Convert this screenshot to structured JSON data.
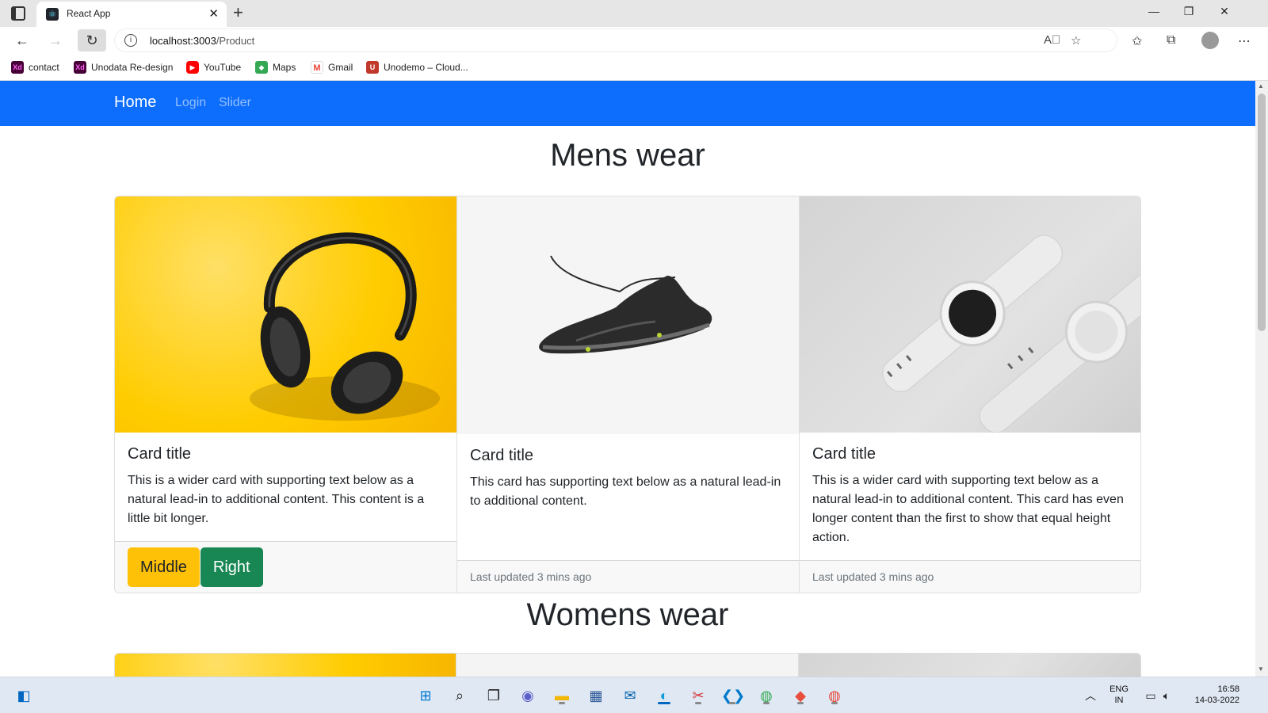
{
  "browser": {
    "tab_title": "React App",
    "tab_close": "✕",
    "new_tab": "+",
    "window_controls": {
      "minimize": "—",
      "restore": "❐",
      "close": "✕"
    },
    "url_host": "localhost:3003",
    "url_path": "/Product",
    "bookmarks": [
      {
        "label": "contact",
        "icon": "Xd"
      },
      {
        "label": "Unodata Re-design",
        "icon": "Xd"
      },
      {
        "label": "YouTube",
        "icon": "▶"
      },
      {
        "label": "Maps",
        "icon": "◆"
      },
      {
        "label": "Gmail",
        "icon": "M"
      },
      {
        "label": "Unodemo – Cloud...",
        "icon": "U"
      }
    ]
  },
  "navbar": {
    "brand": "Home",
    "links": [
      "Login",
      "Slider"
    ],
    "bg_color": "#0d6efd"
  },
  "sections": [
    {
      "title": "Mens wear",
      "cards": [
        {
          "image": "headphones",
          "title": "Card title",
          "text": "This is a wider card with supporting text below as a natural lead-in to additional content. This content is a little bit longer.",
          "buttons": [
            "Middle",
            "Right"
          ]
        },
        {
          "image": "sneaker",
          "title": "Card title",
          "text": "This card has supporting text below as a natural lead-in to additional content.",
          "footer": "Last updated 3 mins ago"
        },
        {
          "image": "smartwatches",
          "title": "Card title",
          "text": "This is a wider card with supporting text below as a natural lead-in to additional content. This card has even longer content than the first to show that equal height action.",
          "footer": "Last updated 3 mins ago"
        }
      ]
    },
    {
      "title": "Womens wear"
    }
  ],
  "taskbar": {
    "lang": "ENG",
    "region": "IN",
    "time": "16:58",
    "date": "14-03-2022"
  }
}
